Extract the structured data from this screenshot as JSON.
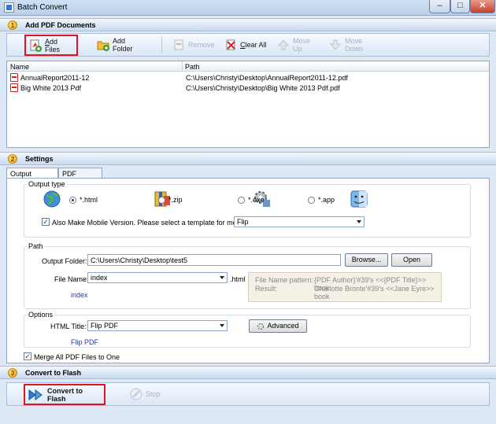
{
  "window": {
    "title": "Batch Convert",
    "minimize": "–",
    "maximize": "□",
    "close": "✕"
  },
  "add_section": {
    "number": "1",
    "title": "Add PDF Documents",
    "toolbar": {
      "add_files_prefix": "",
      "add_files_ul": "A",
      "add_files_rest": "dd Files",
      "add_folder": "Add Folder",
      "remove": "Remove",
      "clear_all_ul": "C",
      "clear_all_rest": "lear All",
      "move_up": "Move Up",
      "move_down": "Move Down"
    },
    "columns": [
      "Name",
      "Path"
    ],
    "files": [
      {
        "name": "AnnualReport2011-12",
        "path": "C:\\Users\\Christy\\Desktop\\AnnualReport2011-12.pdf"
      },
      {
        "name": "Big White 2013 Pdf",
        "path": "C:\\Users\\Christy\\Desktop\\Big White 2013 Pdf.pdf"
      }
    ]
  },
  "settings_section": {
    "number": "2",
    "title": "Settings",
    "tabs": [
      "Output Settings",
      "PDF Setting"
    ],
    "output_type": {
      "title": "Output type",
      "options": [
        "*.html",
        "*.zip",
        "*.exe",
        "*.app"
      ],
      "selected": "*.html"
    },
    "mobile": {
      "checked": true,
      "label": "Also Make Mobile Version. Please select a template for mobile:",
      "template": "Flip"
    },
    "path": {
      "title": "Path",
      "output_folder_label": "Output Folder:",
      "output_folder": "C:\\Users\\Christy\\Desktop\\test5",
      "browse": "Browse...",
      "open": "Open",
      "file_name_label": "File Name:",
      "file_name": "index",
      "ext": ".html",
      "preview": "index",
      "pattern_label": "File Name pattern:",
      "pattern_value": "{PDF Author}'#39's <<{PDF Title}>> book",
      "result_label": "Result:",
      "result_value": "Charlotte Bronte'#39's <<Jane Eyre>> book"
    },
    "options": {
      "title": "Options",
      "html_title_label": "HTML Title:",
      "html_title": "Flip PDF",
      "advanced": "Advanced",
      "preview": "Flip PDF"
    },
    "merge": {
      "checked": true,
      "label": "Merge All PDF Files to One"
    }
  },
  "convert_section": {
    "number": "3",
    "title": "Convert to Flash",
    "convert_btn": "Convert to Flash",
    "stop_btn": "Stop"
  }
}
